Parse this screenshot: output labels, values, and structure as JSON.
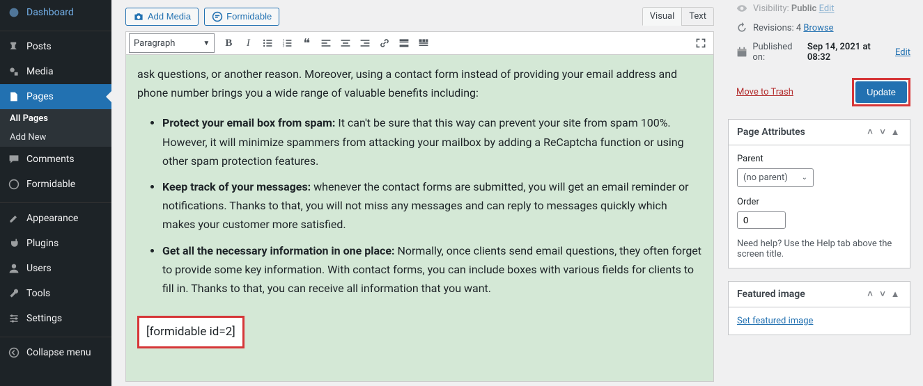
{
  "sidebar": {
    "dashboard": "Dashboard",
    "posts": "Posts",
    "media": "Media",
    "pages": "Pages",
    "all_pages": "All Pages",
    "add_new": "Add New",
    "comments": "Comments",
    "formidable": "Formidable",
    "appearance": "Appearance",
    "plugins": "Plugins",
    "users": "Users",
    "tools": "Tools",
    "settings": "Settings",
    "collapse": "Collapse menu"
  },
  "editor": {
    "add_media": "Add Media",
    "formidable_btn": "Formidable",
    "tab_visual": "Visual",
    "tab_text": "Text",
    "format_select": "Paragraph",
    "intro": "ask questions, or another reason. Moreover, using a contact form instead of providing your email address and phone number brings you a wide range of valuable benefits including:",
    "bullets": [
      {
        "strong": "Protect your email box from spam:",
        "rest": " It can't be sure that this way can prevent your site from spam 100%. However, it will minimize spammers from attacking your mailbox by adding a ReCaptcha function or using other spam protection features."
      },
      {
        "strong": "Keep track of your messages:",
        "rest": " whenever the contact forms are submitted, you will get an email reminder or notifications. Thanks to that, you will not miss any messages and can reply to messages quickly which makes your customer more satisfied."
      },
      {
        "strong": "Get all the necessary information in one place:",
        "rest": " Normally, once clients send email questions, they often forget to provide some key information. With contact forms, you can include boxes with various fields for clients to fill in. Thanks to that, you can receive all information that you want."
      }
    ],
    "shortcode": "[formidable id=2]"
  },
  "publish": {
    "visibility_label": "Visibility:",
    "visibility_value": "Public",
    "visibility_edit": "Edit",
    "revisions_label": "Revisions:",
    "revisions_count": "4",
    "revisions_browse": "Browse",
    "published_label": "Published on:",
    "published_value": "Sep 14, 2021 at 08:32",
    "published_edit": "Edit",
    "trash": "Move to Trash",
    "update": "Update"
  },
  "page_attributes": {
    "title": "Page Attributes",
    "parent_label": "Parent",
    "parent_value": "(no parent)",
    "order_label": "Order",
    "order_value": "0",
    "help": "Need help? Use the Help tab above the screen title."
  },
  "featured": {
    "title": "Featured image",
    "set": "Set featured image"
  }
}
